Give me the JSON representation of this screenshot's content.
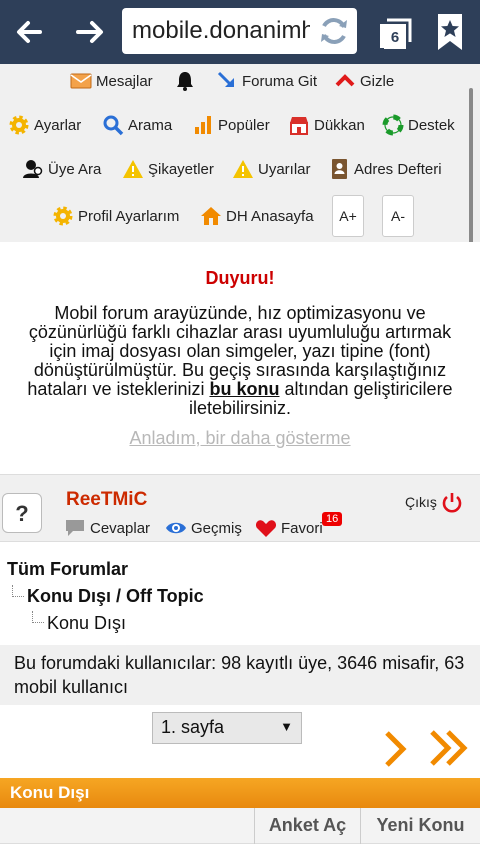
{
  "browser": {
    "url": "mobile.donanimhaber.com",
    "tab_count": "6"
  },
  "menu": {
    "row1": [
      {
        "label": "Mesajlar",
        "icon": "envelope-icon"
      },
      {
        "label": "",
        "icon": "bell-icon"
      },
      {
        "label": "Foruma Git",
        "icon": "goto-arrow-icon"
      },
      {
        "label": "Gizle",
        "icon": "chevron-up-icon"
      }
    ],
    "row2": [
      {
        "label": "Ayarlar",
        "icon": "gear-icon"
      },
      {
        "label": "Arama",
        "icon": "search-icon"
      },
      {
        "label": "Popüler",
        "icon": "bar-chart-icon"
      },
      {
        "label": "Dükkan",
        "icon": "shop-icon"
      },
      {
        "label": "Destek",
        "icon": "lifebuoy-icon"
      }
    ],
    "row3": [
      {
        "label": "Üye Ara",
        "icon": "user-search-icon"
      },
      {
        "label": "Şikayetler",
        "icon": "warning-icon"
      },
      {
        "label": "Uyarılar",
        "icon": "warning-icon"
      },
      {
        "label": "Adres Defteri",
        "icon": "address-book-icon"
      }
    ],
    "row4": [
      {
        "label": "Profil Ayarlarım",
        "icon": "gear-icon"
      },
      {
        "label": "DH Anasayfa",
        "icon": "home-icon"
      }
    ],
    "font_increase": "A+",
    "font_decrease": "A-"
  },
  "announcement": {
    "title": "Duyuru!",
    "body_before": "Mobil forum arayüzünde, hız optimizasyonu ve çözünürlüğü farklı cihazlar arası uyumluluğu artırmak için imaj dosyası olan simgeler, yazı tipine (font) dönüştürülmüştür. Bu geçiş sırasında karşılaştığınız hataları ve isteklerinizi ",
    "link": "bu konu",
    "body_after": " altından geliştiricilere iletebilirsiniz.",
    "dismiss": "Anladım, bir daha gösterme"
  },
  "user": {
    "avatar": "?",
    "name": "ReeTMiC",
    "replies": "Cevaplar",
    "history": "Geçmiş",
    "favorites": "Favori",
    "favorites_count": "16",
    "logout": "Çıkış"
  },
  "breadcrumb": {
    "root": "Tüm Forumlar",
    "level1": "Konu Dışı / Off Topic",
    "level2": "Konu Dışı"
  },
  "info": "Bu forumdaki kullanıcılar: 98 kayıtlı üye, 3646 misafir, 63 mobil kullanıcı",
  "pager": {
    "selected": "1. sayfa"
  },
  "section": {
    "title": "Konu Dışı",
    "poll_button": "Anket Aç",
    "new_topic_button": "Yeni Konu"
  },
  "colors": {
    "toolbar": "#2e3f59",
    "accent_orange": "#f18a00",
    "username_red": "#cc2a00",
    "announce_red": "#cc0000"
  }
}
